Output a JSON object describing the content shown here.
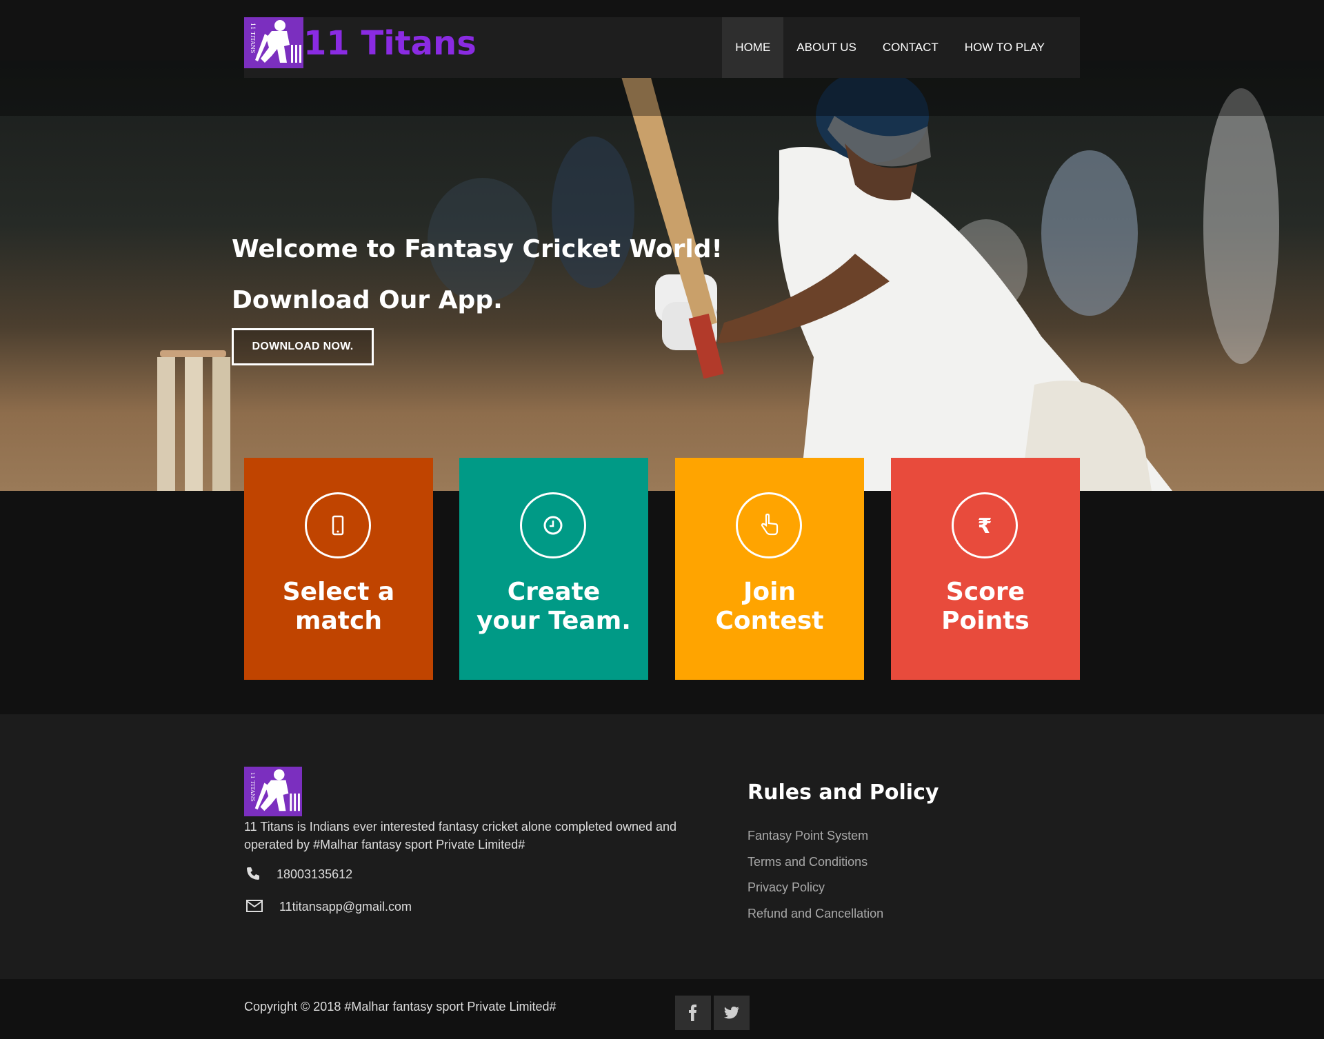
{
  "header": {
    "brand": "11 Titans",
    "logo_icon": "batsman-logo-icon",
    "nav": [
      {
        "label": "HOME",
        "active": true
      },
      {
        "label": "ABOUT US",
        "active": false
      },
      {
        "label": "CONTACT",
        "active": false
      },
      {
        "label": "HOW TO PLAY",
        "active": false
      }
    ]
  },
  "hero": {
    "line1": "Welcome to Fantasy Cricket World!",
    "line2": "Download Our App.",
    "button_label": "DOWNLOAD NOW."
  },
  "steps": [
    {
      "title": "Select a\nmatch",
      "icon": "mobile-phone-icon",
      "color": "#c04400"
    },
    {
      "title": "Create\nyour Team.",
      "icon": "clock-icon",
      "color": "#009a86"
    },
    {
      "title": "Join\nContest",
      "icon": "pointing-hand-icon",
      "color": "#ffa400"
    },
    {
      "title": "Score\nPoints",
      "icon": "rupee-icon",
      "color": "#e84b3c"
    }
  ],
  "footer": {
    "description": "11 Titans is Indians ever interested fantasy cricket alone completed owned and operated by #Malhar fantasy sport Private Limited#",
    "phone": "18003135612",
    "email": "11titansapp@gmail.com",
    "rules_title": "Rules and Policy",
    "rules_links": [
      "Fantasy Point System",
      "Terms and Conditions",
      "Privacy Policy",
      "Refund and Cancellation"
    ],
    "copyright": "Copyright © 2018 #Malhar fantasy sport Private Limited#",
    "social": [
      "facebook-icon",
      "twitter-icon"
    ]
  },
  "colors": {
    "brand_purple": "#8a2be2",
    "logo_bg": "#7b2fbf",
    "card_orange": "#c04400",
    "card_teal": "#009a86",
    "card_amber": "#ffa400",
    "card_red": "#e84b3c"
  }
}
